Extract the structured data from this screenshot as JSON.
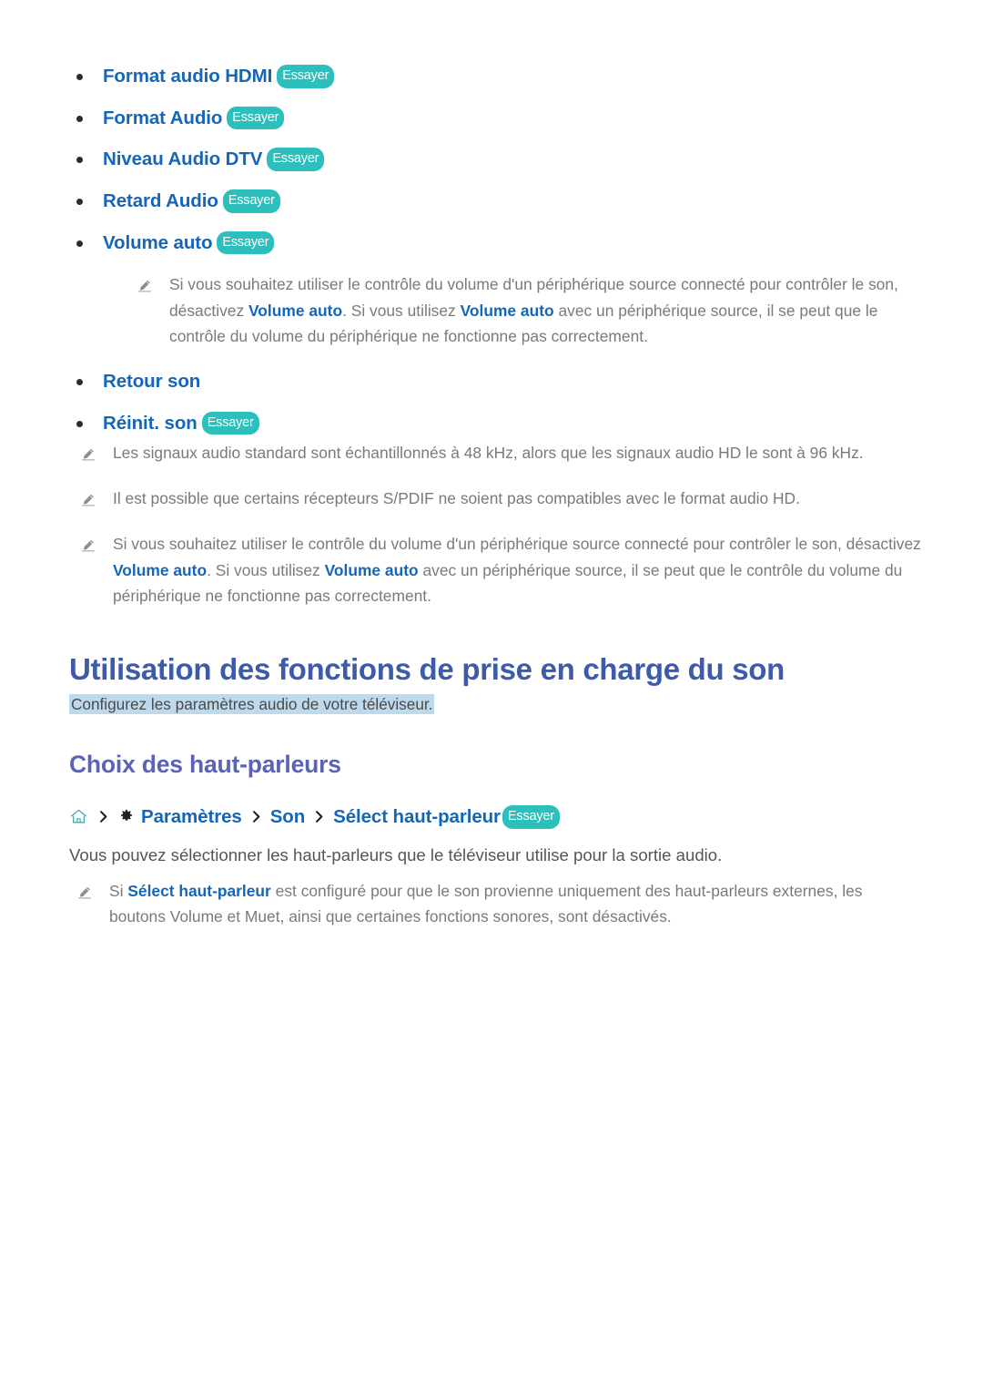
{
  "badge_label": "Essayer",
  "menu_list": {
    "items": [
      {
        "label": "Format audio HDMI",
        "badge": true
      },
      {
        "label": "Format Audio",
        "badge": true
      },
      {
        "label": "Niveau Audio DTV",
        "badge": true
      },
      {
        "label": "Retard Audio",
        "badge": true
      },
      {
        "label": "Volume auto",
        "badge": true
      }
    ],
    "items_after_note": [
      {
        "label": "Retour son",
        "badge": false
      },
      {
        "label": "Réinit. son",
        "badge": true
      }
    ]
  },
  "nested_note": {
    "text_1": "Si vous souhaitez utiliser le contrôle du volume d'un périphérique source connecté pour contrôler le son, désactivez ",
    "link_1": "Volume auto",
    "text_2": ". Si vous utilisez ",
    "link_2": "Volume auto",
    "text_3": " avec un périphérique source, il se peut que le contrôle du volume du périphérique ne fonctionne pas correctement."
  },
  "notes": {
    "note_1": "Les signaux audio standard sont échantillonnés à 48 kHz, alors que les signaux audio HD le sont à 96 kHz.",
    "note_2": "Il est possible que certains récepteurs S/PDIF ne soient pas compatibles avec le format audio HD.",
    "note_3": {
      "text_1": "Si vous souhaitez utiliser le contrôle du volume d'un périphérique source connecté pour contrôler le son, désactivez ",
      "link_1": "Volume auto",
      "text_2": ". Si vous utilisez ",
      "link_2": "Volume auto",
      "text_3": " avec un périphérique source, il se peut que le contrôle du volume du périphérique ne fonctionne pas correctement."
    }
  },
  "section": {
    "heading": "Utilisation des fonctions de prise en charge du son",
    "subtitle": "Configurez les paramètres audio de votre téléviseur.",
    "sub_heading": "Choix des haut-parleurs"
  },
  "breadcrumb": {
    "home_icon": "home-icon",
    "gear_icon": "gear-icon",
    "separator": "chevron-right-icon",
    "crumb_1": "Paramètres",
    "crumb_2": "Son",
    "crumb_3": "Sélect haut-parleur",
    "badge": "Essayer"
  },
  "body": {
    "paragraph": "Vous pouvez sélectionner les haut-parleurs que le téléviseur utilise pour la sortie audio."
  },
  "last_note": {
    "text_1": "Si ",
    "link_1": "Sélect haut-parleur",
    "text_2": " est configuré pour que le son provienne uniquement des haut-parleurs externes, les boutons Volume et Muet, ainsi que certaines fonctions sonores, sont désactivés."
  },
  "colors": {
    "link_blue": "#1666b8",
    "badge_teal": "#2cbfbb",
    "heading_navy": "#3d5ba9",
    "subheading_purple": "#5a63b5",
    "highlight_blue": "#bfd9ec",
    "body_gray": "#7a7a7a"
  }
}
